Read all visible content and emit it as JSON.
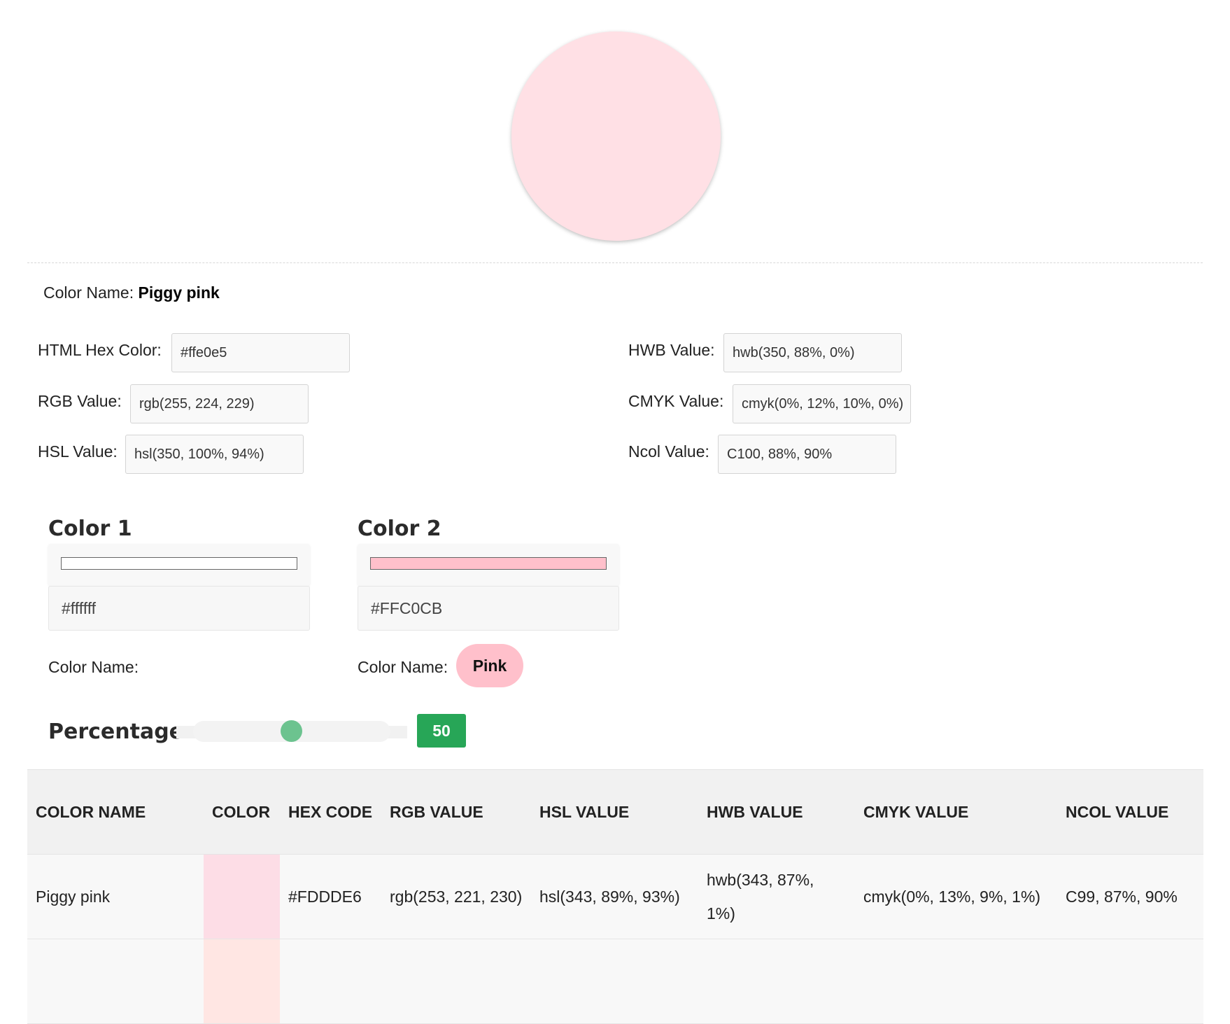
{
  "colors": {
    "main": "#ffe0e5",
    "color1": "#ffffff",
    "color2": "#ffc0cb",
    "badge": "#27a657",
    "slider_thumb": "#6cc38f",
    "row_swatch": "#fddde6",
    "next_row_swatch": "#ffe6e3"
  },
  "color_name": {
    "label": "Color Name:",
    "value": "Piggy pink"
  },
  "values": {
    "hex": {
      "label": "HTML Hex Color:",
      "value": "#ffe0e5"
    },
    "rgb": {
      "label": "RGB Value:",
      "value": "rgb(255, 224, 229)"
    },
    "hsl": {
      "label": "HSL Value:",
      "value": "hsl(350, 100%, 94%)"
    },
    "hwb": {
      "label": "HWB Value:",
      "value": "hwb(350, 88%, 0%)"
    },
    "cmyk": {
      "label": "CMYK Value:",
      "value": "cmyk(0%, 12%, 10%, 0%)"
    },
    "ncol": {
      "label": "Ncol Value:",
      "value": "C100, 88%, 90%"
    }
  },
  "mixer": {
    "color1": {
      "heading": "Color 1",
      "hex": "#ffffff",
      "name_label": "Color Name:",
      "name": ""
    },
    "color2": {
      "heading": "Color 2",
      "hex": "#FFC0CB",
      "name_label": "Color Name:",
      "name": "Pink"
    },
    "percentage": {
      "heading": "Percentage",
      "value": 50
    }
  },
  "table": {
    "headers": [
      "COLOR NAME",
      "COLOR",
      "HEX CODE",
      "RGB VALUE",
      "HSL VALUE",
      "HWB VALUE",
      "CMYK VALUE",
      "NCOL VALUE"
    ],
    "rows": [
      {
        "name": "Piggy pink",
        "hex": "#FDDDE6",
        "rgb": "rgb(253, 221, 230)",
        "hsl": "hsl(343, 89%, 93%)",
        "hwb": "hwb(343, 87%, 1%)",
        "cmyk": "cmyk(0%, 13%, 9%, 1%)",
        "ncol": "C99, 87%, 90%"
      }
    ]
  }
}
